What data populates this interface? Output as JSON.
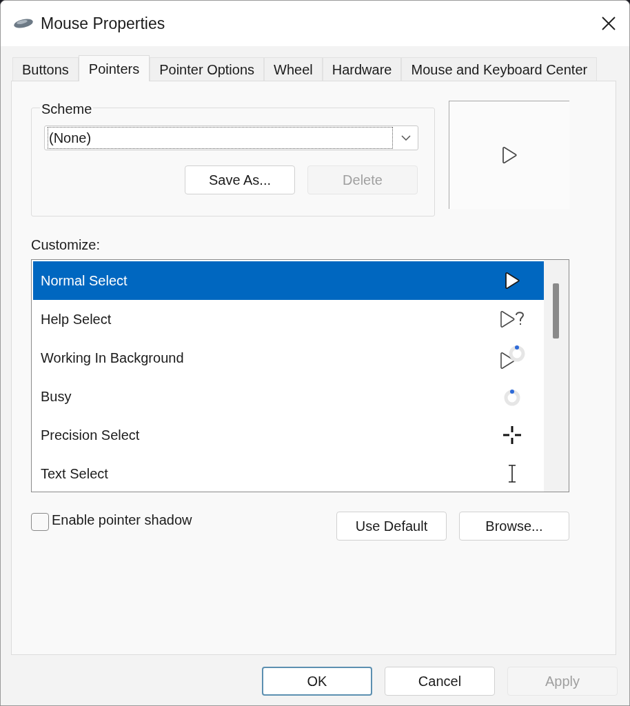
{
  "window": {
    "title": "Mouse Properties"
  },
  "tabs": [
    {
      "label": "Buttons",
      "selected": false
    },
    {
      "label": "Pointers",
      "selected": true
    },
    {
      "label": "Pointer Options",
      "selected": false
    },
    {
      "label": "Wheel",
      "selected": false
    },
    {
      "label": "Hardware",
      "selected": false
    },
    {
      "label": "Mouse and Keyboard Center",
      "selected": false
    }
  ],
  "scheme": {
    "label": "Scheme",
    "value": "(None)",
    "buttons": [
      {
        "label": "Save As...",
        "disabled": false
      },
      {
        "label": "Delete",
        "disabled": true
      }
    ]
  },
  "customize": {
    "label": "Customize:",
    "items": [
      {
        "name": "Normal Select",
        "kind": "normal",
        "selected": true
      },
      {
        "name": "Help Select",
        "kind": "help",
        "selected": false
      },
      {
        "name": "Working In Background",
        "kind": "working",
        "selected": false
      },
      {
        "name": "Busy",
        "kind": "busy",
        "selected": false
      },
      {
        "name": "Precision Select",
        "kind": "precision",
        "selected": false
      },
      {
        "name": "Text Select",
        "kind": "text",
        "selected": false
      }
    ]
  },
  "pointer_shadow": {
    "label": "Enable pointer shadow",
    "checked": false
  },
  "list_buttons": [
    {
      "label": "Use Default"
    },
    {
      "label": "Browse..."
    }
  ],
  "dialog_buttons": [
    {
      "label": "OK",
      "default": true,
      "disabled": false
    },
    {
      "label": "Cancel",
      "default": false,
      "disabled": false
    },
    {
      "label": "Apply",
      "default": false,
      "disabled": true
    }
  ]
}
